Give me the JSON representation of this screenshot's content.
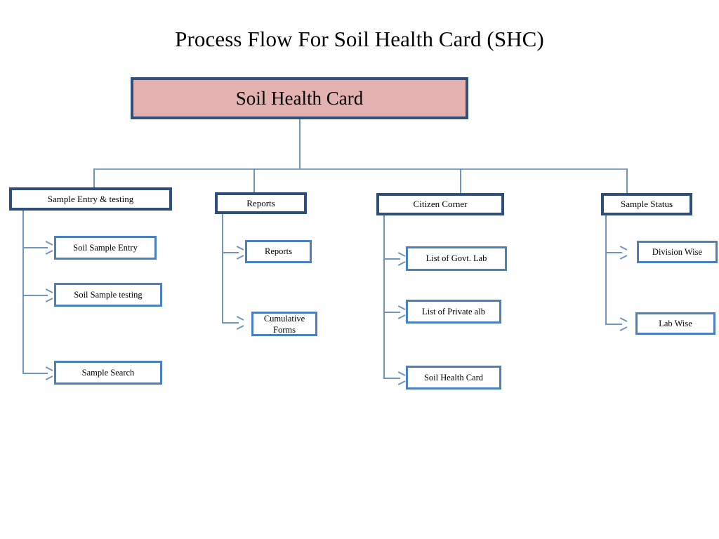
{
  "title": "Process Flow For Soil Health Card (SHC)",
  "colors": {
    "root_fill": "#e4b1b1",
    "root_border": "#31517d",
    "level2_border": "#2e4f7c",
    "level3_border": "#4a80bf",
    "connector": "#6f95c1",
    "text": "#000000",
    "background": "#ffffff"
  },
  "chart_data": {
    "type": "diagram",
    "diagram_type": "org-chart",
    "title": "Process Flow For Soil Health Card (SHC)",
    "root": "Soil Health Card",
    "levels": 3,
    "branches": [
      {
        "label": "Sample Entry & testing",
        "children": [
          "Soil Sample Entry",
          "Soil Sample testing",
          "Sample Search"
        ]
      },
      {
        "label": "Reports",
        "children": [
          "Reports",
          "Cumulative Forms"
        ]
      },
      {
        "label": "Citizen Corner",
        "children": [
          "List of Govt. Lab",
          "List of Private alb",
          "Soil Health Card"
        ]
      },
      {
        "label": "Sample Status",
        "children": [
          "Division Wise",
          "Lab Wise"
        ]
      }
    ]
  },
  "root": {
    "label": "Soil Health Card"
  },
  "branches": [
    {
      "label": "Sample Entry & testing",
      "children": [
        {
          "label": "Soil Sample Entry"
        },
        {
          "label": "Soil Sample testing"
        },
        {
          "label": "Sample Search"
        }
      ]
    },
    {
      "label": "Reports",
      "children": [
        {
          "label": "Reports"
        },
        {
          "label": "Cumulative Forms",
          "line1": "Cumulative",
          "line2": "Forms"
        }
      ]
    },
    {
      "label": "Citizen Corner",
      "children": [
        {
          "label": "List of Govt. Lab"
        },
        {
          "label": "List of Private alb"
        },
        {
          "label": "Soil Health Card"
        }
      ]
    },
    {
      "label": "Sample Status",
      "children": [
        {
          "label": "Division Wise"
        },
        {
          "label": "Lab Wise"
        }
      ]
    }
  ]
}
